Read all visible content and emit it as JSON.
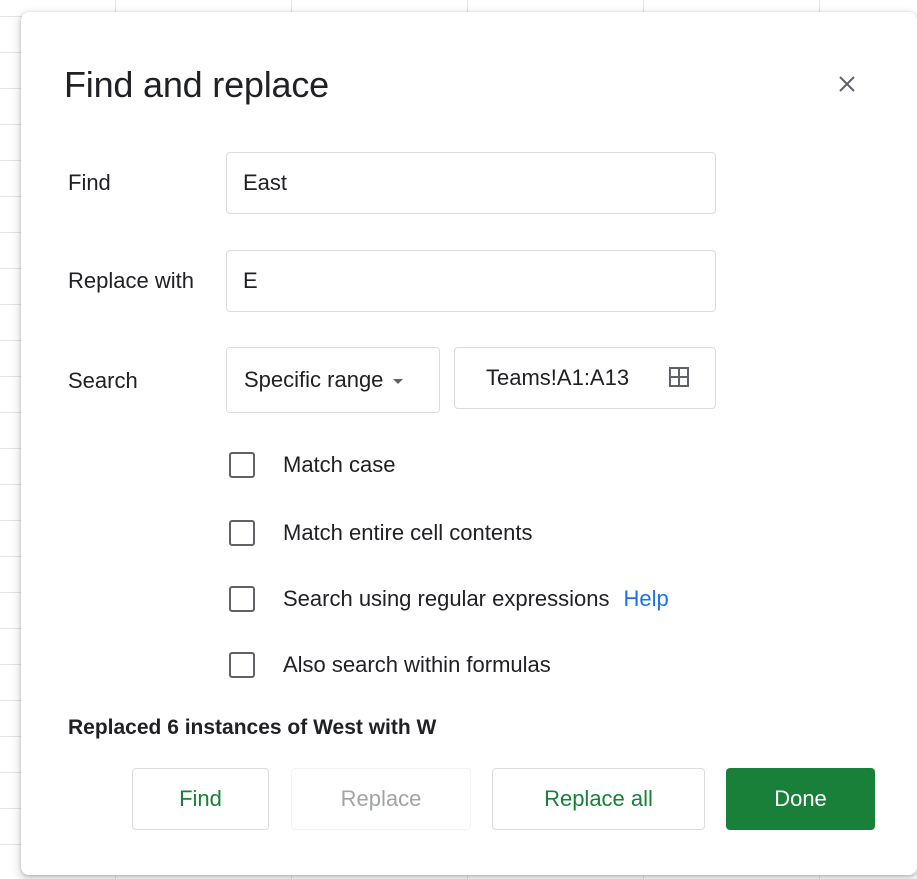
{
  "dialog": {
    "title": "Find and replace",
    "close_icon": "close-icon"
  },
  "find": {
    "label": "Find",
    "value": "East"
  },
  "replace": {
    "label": "Replace with",
    "value": "E"
  },
  "search": {
    "label": "Search",
    "scope": "Specific range",
    "range": "Teams!A1:A13",
    "range_icon": "grid-select-icon"
  },
  "options": [
    {
      "label": "Match case",
      "checked": false
    },
    {
      "label": "Match entire cell contents",
      "checked": false
    },
    {
      "label": "Search using regular expressions",
      "checked": false,
      "link": "Help"
    },
    {
      "label": "Also search within formulas",
      "checked": false
    }
  ],
  "status": "Replaced 6 instances of West with W",
  "buttons": {
    "find": "Find",
    "replace": "Replace",
    "replace_all": "Replace all",
    "done": "Done"
  },
  "colors": {
    "accent": "#188038",
    "link": "#1a73e8"
  }
}
